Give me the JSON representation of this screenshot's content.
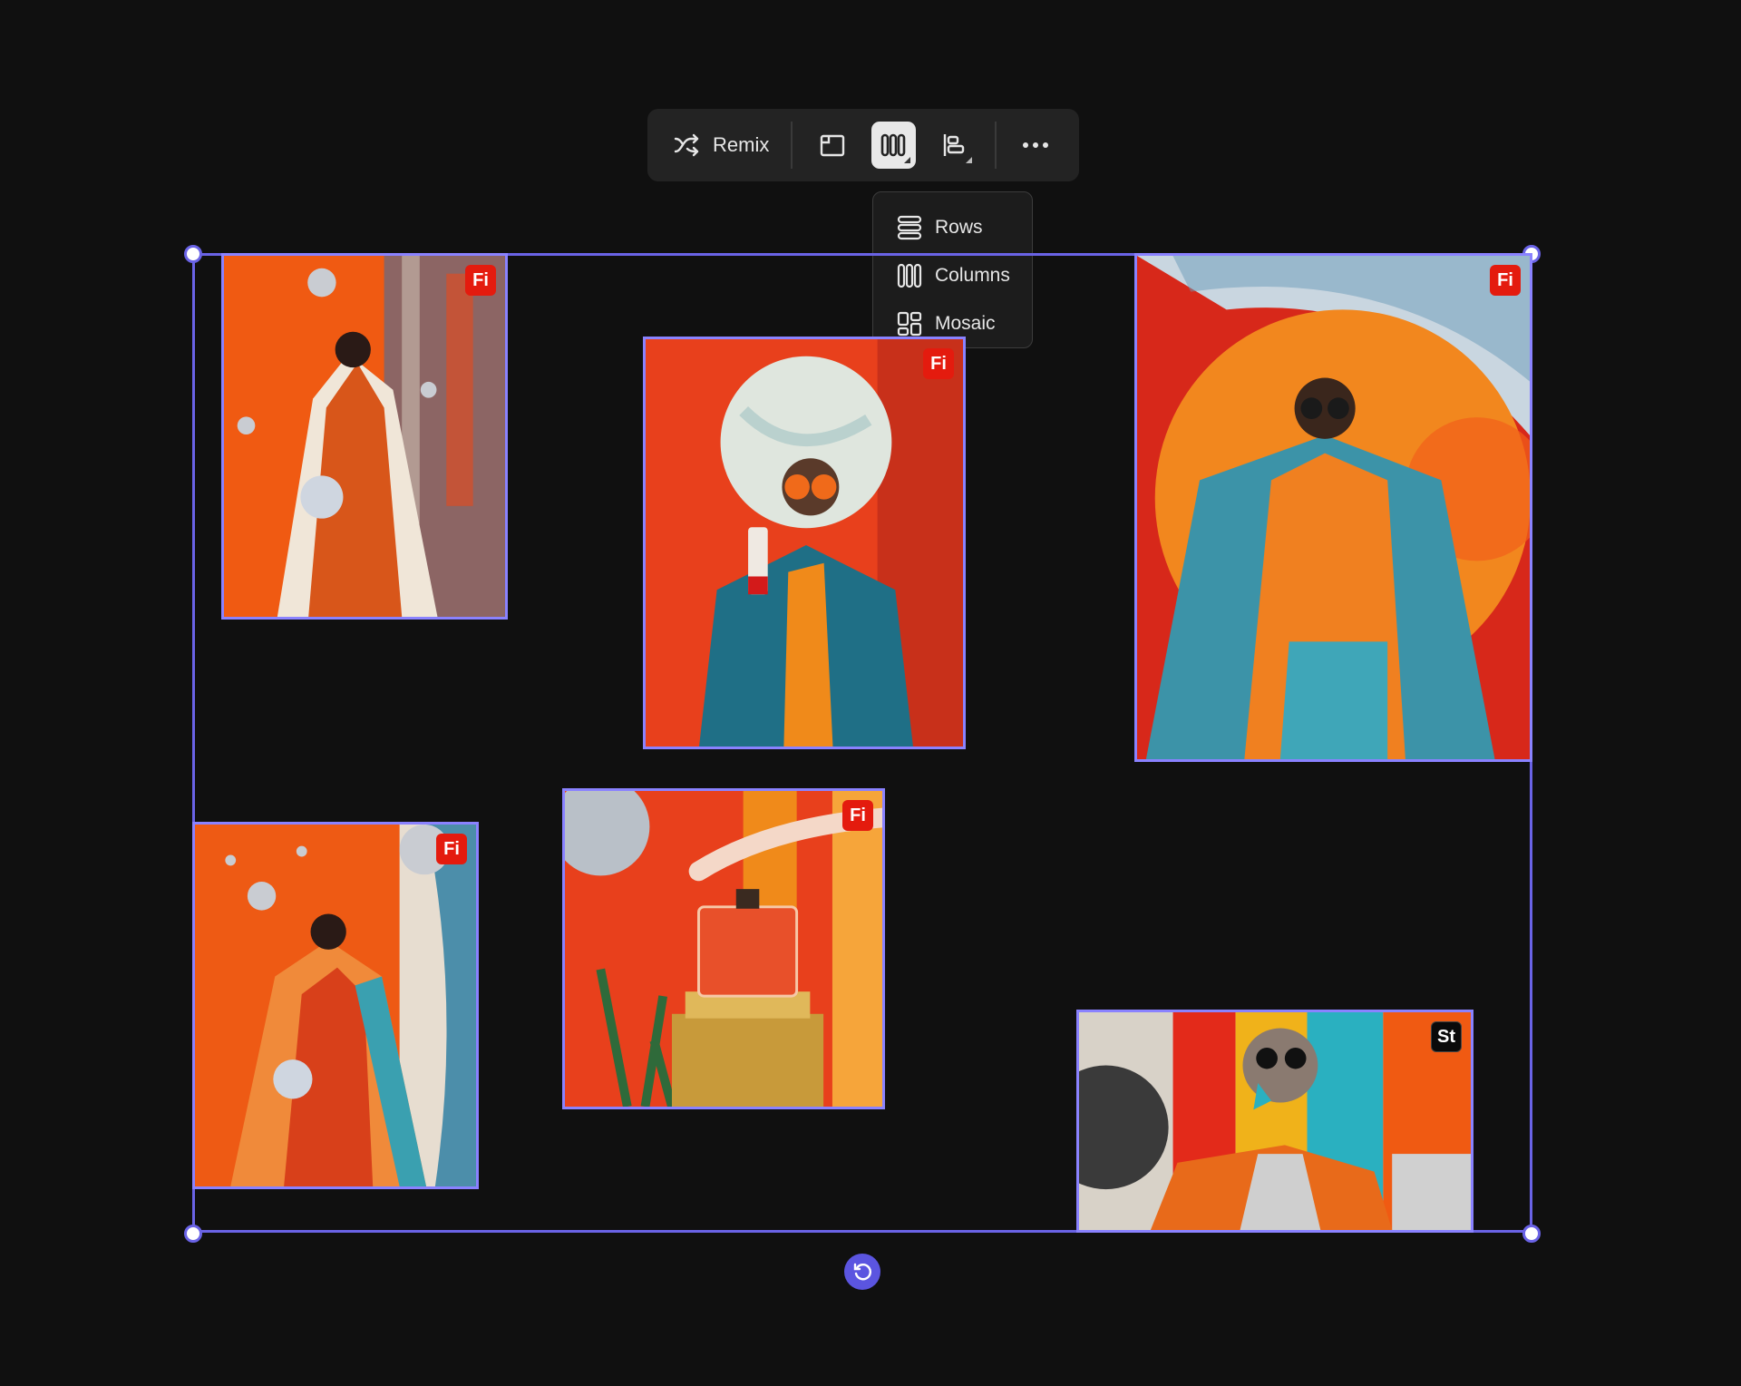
{
  "toolbar": {
    "remix_label": "Remix",
    "icons": [
      "shuffle-icon",
      "frame-icon",
      "columns-layout-icon",
      "align-icon",
      "more-icon"
    ]
  },
  "layout_menu": {
    "items": [
      {
        "label": "Rows",
        "icon": "rows-icon"
      },
      {
        "label": "Columns",
        "icon": "columns-icon"
      },
      {
        "label": "Mosaic",
        "icon": "mosaic-icon"
      }
    ],
    "selected": "Columns"
  },
  "images": [
    {
      "badge": "Fi",
      "subject": "woman in orange sequin dress with disco balls"
    },
    {
      "badge": "Fi",
      "subject": "woman in teal fur coat holding perfume bottle"
    },
    {
      "badge": "Fi",
      "subject": "woman in fur coat before orange circle"
    },
    {
      "badge": "Fi",
      "subject": "woman in orange coat with disco balls"
    },
    {
      "badge": "Fi",
      "subject": "hand touching perfume bottle on gold pedestal"
    },
    {
      "badge": "St",
      "subject": "collage portrait of woman in sunglasses"
    }
  ],
  "colors": {
    "accent": "#6a63e6",
    "image_border": "#8a82ff",
    "badge_fi": "#e41b0e",
    "badge_st": "#0a0a0a",
    "background": "#101010"
  }
}
